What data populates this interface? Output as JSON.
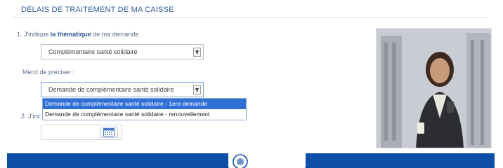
{
  "header": {
    "title": "DÉLAIS DE TRAITEMENT DE MA CAISSE"
  },
  "question1": {
    "prefix": "1. J'indique ",
    "bold": "la thématique",
    "suffix": " de ma demande",
    "selected_value": "Complémentaire santé solidaire"
  },
  "precise": {
    "label": "Merci de préciser :",
    "selected_value": "Demande de complémentaire santé solidaire",
    "options": [
      "Demande de complémentaire santé solidaire - 1ere demande",
      "Demande de complémentaire santé solidaire - renouvellement"
    ],
    "highlighted_index": 0
  },
  "question2": {
    "label": "2. J'inc"
  },
  "icons": {
    "select_arrow": "chevron-down-icon",
    "calendar": "calendar-icon",
    "logo": "assurance-maladie-logo"
  },
  "colors": {
    "title": "#2e5a97",
    "highlight": "#2f6fd6",
    "footer": "#0d4ea6"
  }
}
